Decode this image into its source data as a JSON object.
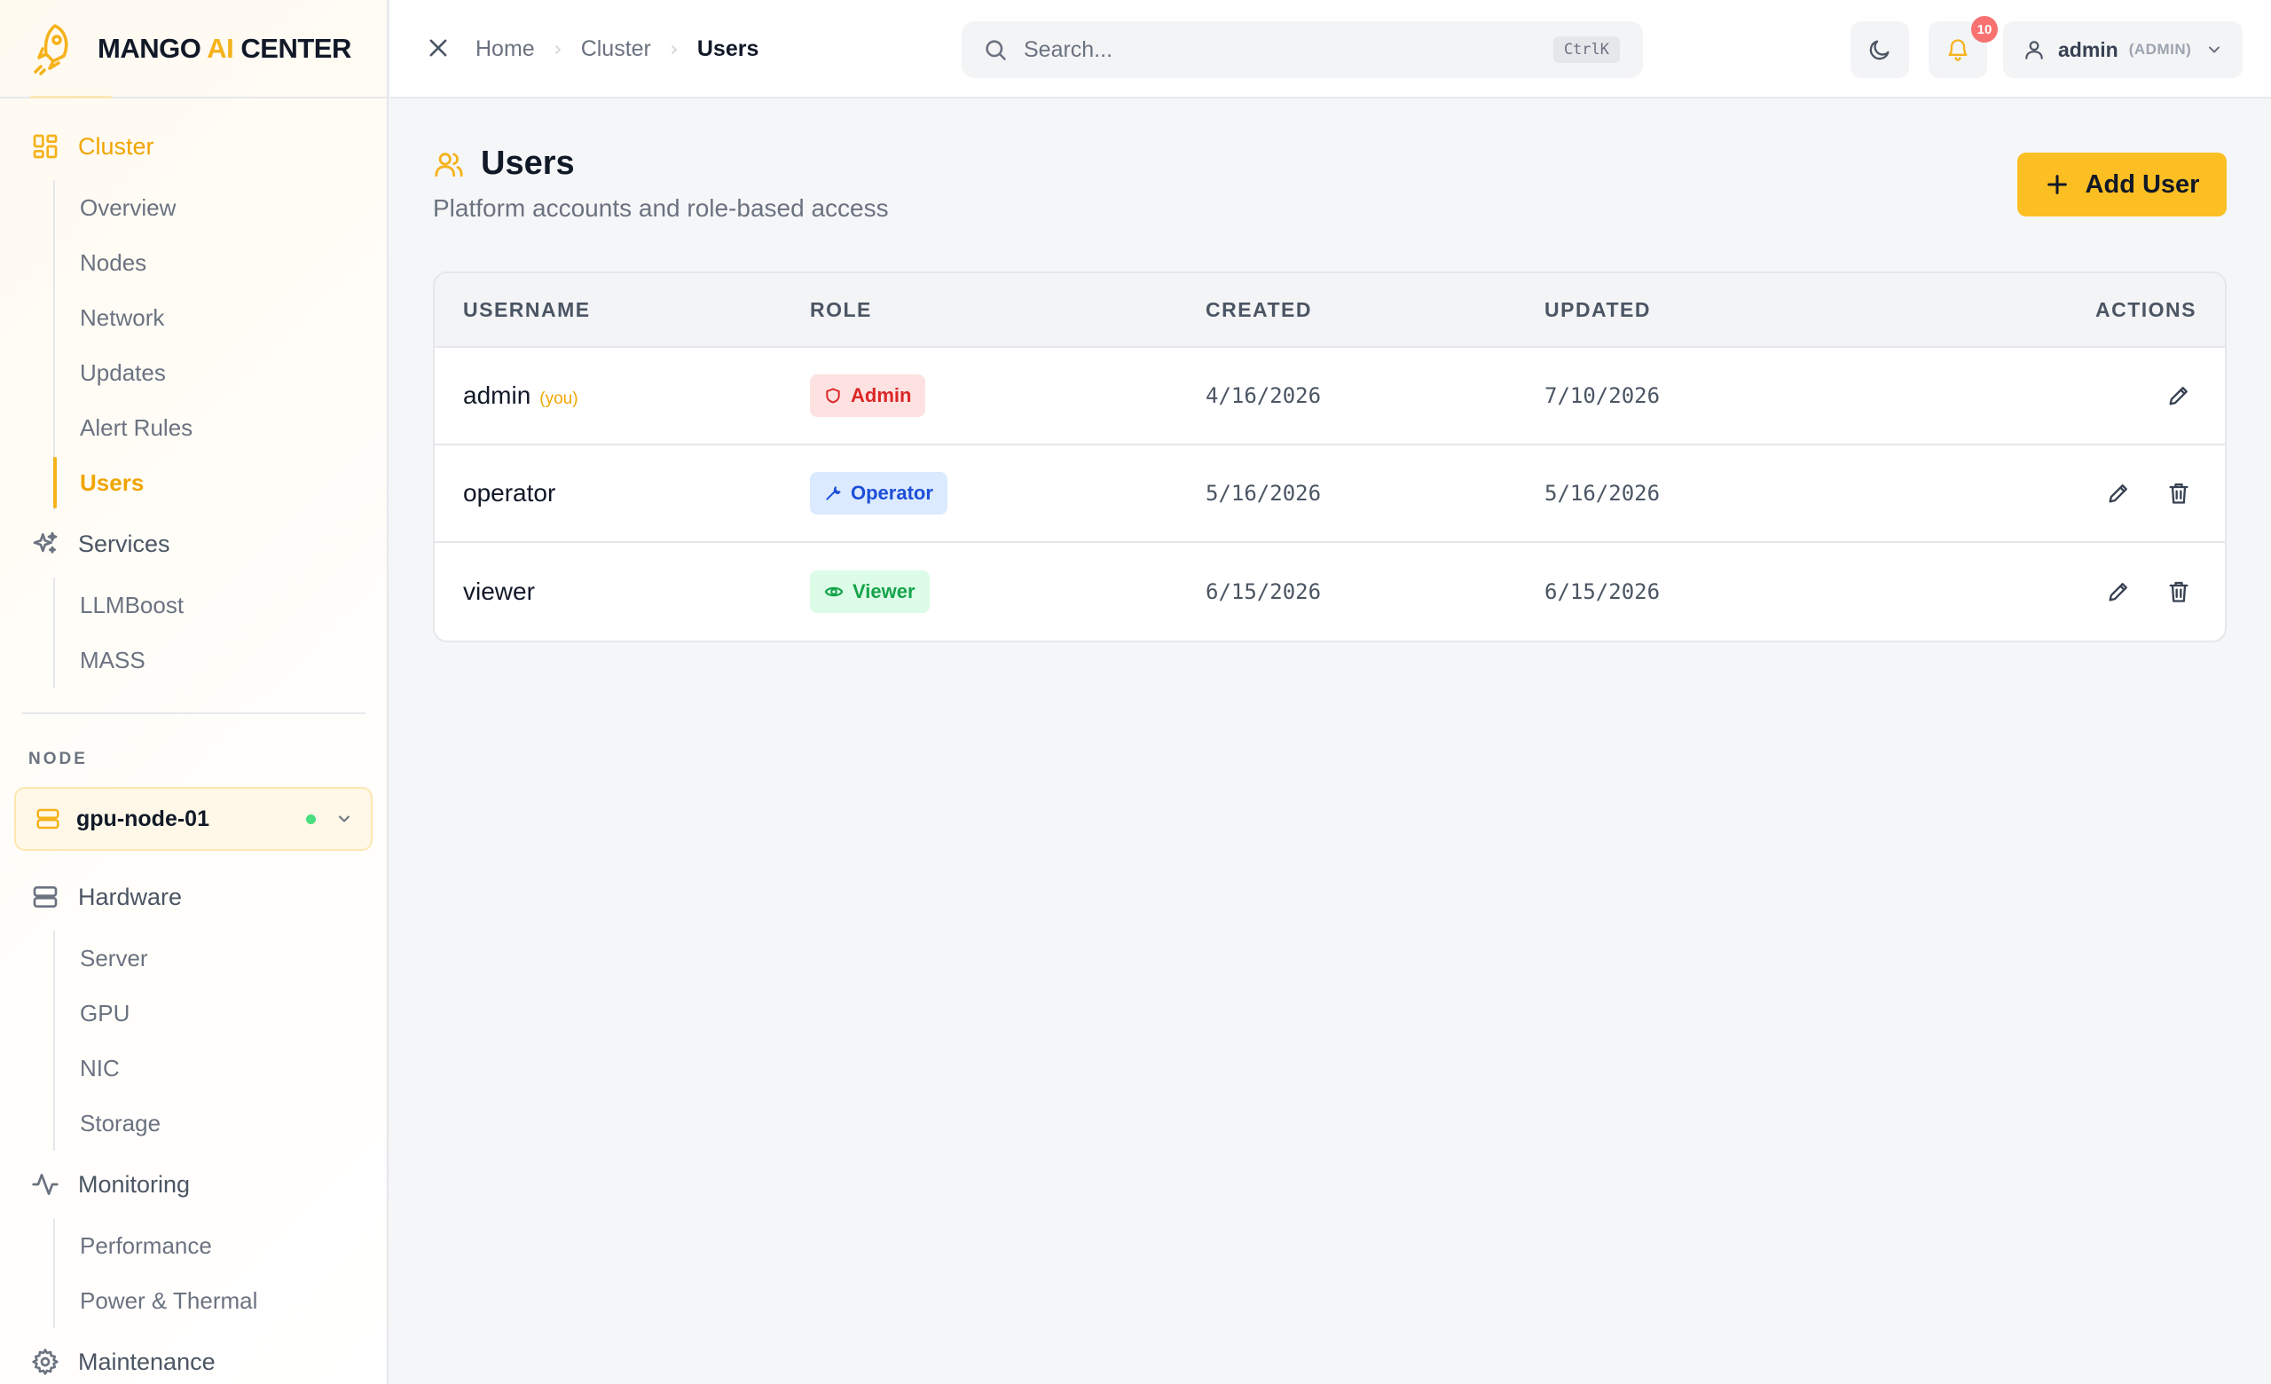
{
  "brand": {
    "name_part1": "MANGO ",
    "name_ai": "AI",
    "name_part2": " CENTER"
  },
  "sidebar": {
    "cluster": {
      "label": "Cluster",
      "items": [
        "Overview",
        "Nodes",
        "Network",
        "Updates",
        "Alert Rules",
        "Users"
      ],
      "active": "Users"
    },
    "services": {
      "label": "Services",
      "items": [
        "LLMBoost",
        "MASS"
      ]
    },
    "node_label": "NODE",
    "node_select": {
      "value": "gpu-node-01",
      "status_color": "#4ade80"
    },
    "hardware": {
      "label": "Hardware",
      "items": [
        "Server",
        "GPU",
        "NIC",
        "Storage"
      ]
    },
    "monitoring": {
      "label": "Monitoring",
      "items": [
        "Performance",
        "Power & Thermal"
      ]
    },
    "maintenance": {
      "label": "Maintenance"
    }
  },
  "topbar": {
    "breadcrumb": [
      "Home",
      "Cluster",
      "Users"
    ],
    "search": {
      "placeholder": "Search...",
      "shortcut": "CtrlK"
    },
    "notifications": {
      "count": "10"
    },
    "user": {
      "name": "admin",
      "role": "(ADMIN)"
    }
  },
  "page": {
    "title": "Users",
    "subtitle": "Platform accounts and role-based access",
    "add_button": "Add User"
  },
  "table": {
    "columns": [
      "USERNAME",
      "ROLE",
      "CREATED",
      "UPDATED",
      "ACTIONS"
    ],
    "rows": [
      {
        "username": "admin",
        "you": "(you)",
        "role": "Admin",
        "created": "4/16/2026",
        "updated": "7/10/2026"
      },
      {
        "username": "operator",
        "you": "",
        "role": "Operator",
        "created": "5/16/2026",
        "updated": "5/16/2026"
      },
      {
        "username": "viewer",
        "you": "",
        "role": "Viewer",
        "created": "6/15/2026",
        "updated": "6/15/2026"
      }
    ]
  },
  "colors": {
    "accent": "#f5b21b",
    "button": "#fbbf24",
    "admin_badge": "#dc2626",
    "operator_badge": "#1d4ed8",
    "viewer_badge": "#16a34a"
  }
}
